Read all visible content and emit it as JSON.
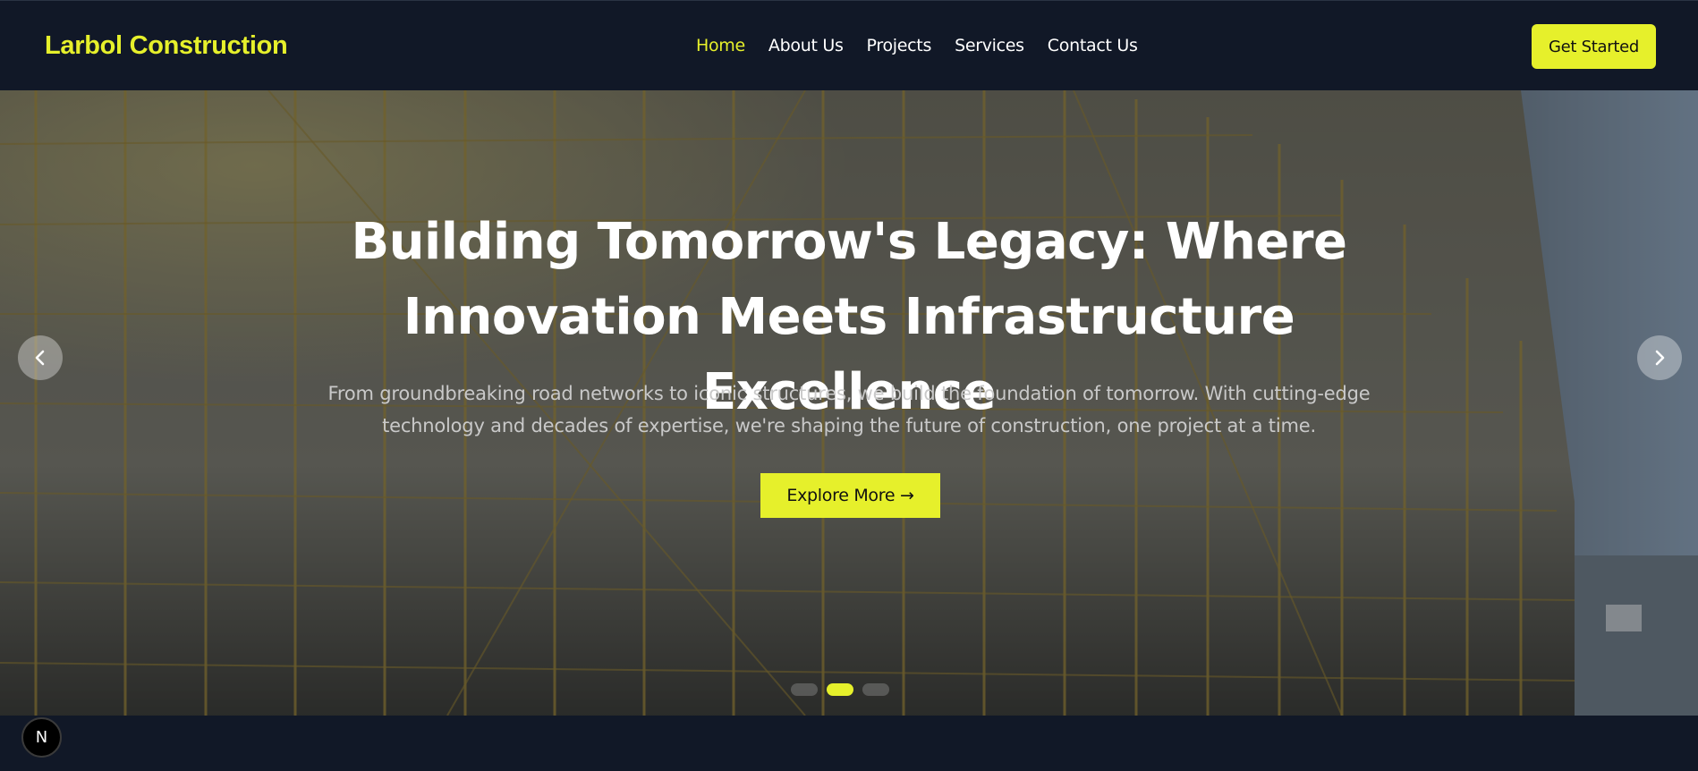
{
  "header": {
    "logo": "Larbol Construction",
    "nav": [
      {
        "label": "Home",
        "active": true
      },
      {
        "label": "About Us",
        "active": false
      },
      {
        "label": "Projects",
        "active": false
      },
      {
        "label": "Services",
        "active": false
      },
      {
        "label": "Contact Us",
        "active": false
      }
    ],
    "cta": "Get Started"
  },
  "hero": {
    "headline": "Building Tomorrow's Legacy: Where Innovation Meets Infrastructure Excellence",
    "subtext": "From groundbreaking road networks to iconic structures, we build the foundation of tomorrow. With cutting-edge technology and decades of expertise, we're shaping the future of construction, one project at a time.",
    "button": "Explore More →",
    "prev_icon": "chevron-left-icon",
    "next_icon": "chevron-right-icon",
    "slides": 3,
    "active_slide": 2
  },
  "badge": {
    "letter": "N",
    "icon": "next-logo-icon"
  },
  "colors": {
    "accent": "#e6f02b",
    "background": "#111827",
    "text": "#ffffff"
  }
}
